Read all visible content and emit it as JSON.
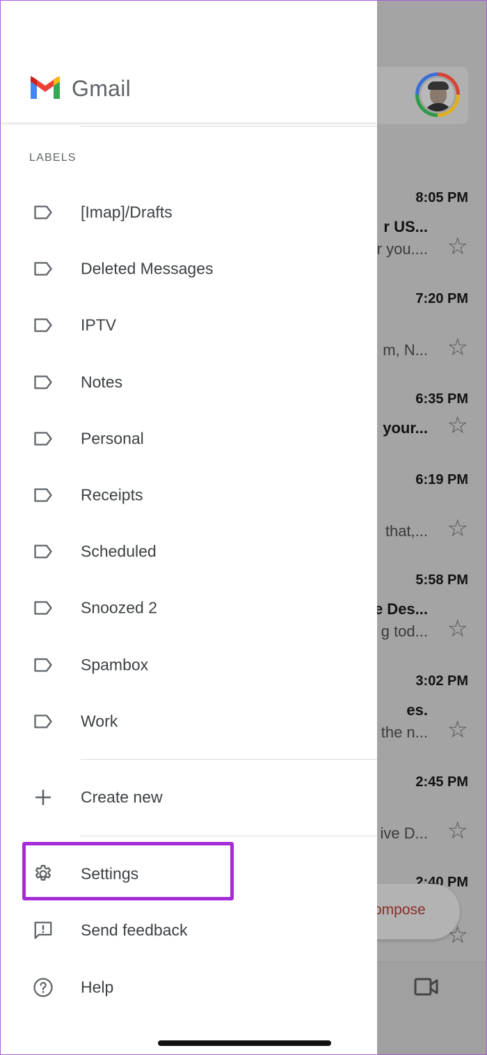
{
  "app": {
    "name": "Gmail"
  },
  "drawer": {
    "labels_heading": "LABELS",
    "labels": [
      {
        "label": "[Imap]/Drafts",
        "icon": "label-icon"
      },
      {
        "label": "Deleted Messages",
        "icon": "label-icon"
      },
      {
        "label": "IPTV",
        "icon": "label-icon"
      },
      {
        "label": "Notes",
        "icon": "label-icon"
      },
      {
        "label": "Personal",
        "icon": "label-icon"
      },
      {
        "label": "Receipts",
        "icon": "label-icon"
      },
      {
        "label": "Scheduled",
        "icon": "label-icon"
      },
      {
        "label": "Snoozed 2",
        "icon": "label-icon"
      },
      {
        "label": "Spambox",
        "icon": "label-icon"
      },
      {
        "label": "Work",
        "icon": "label-icon"
      }
    ],
    "create_new": "Create new",
    "settings": "Settings",
    "send_feedback": "Send feedback",
    "help": "Help"
  },
  "inbox": {
    "emails": [
      {
        "time": "8:05 PM",
        "subject": "r US...",
        "preview": "r you...."
      },
      {
        "time": "7:20 PM",
        "subject": "",
        "preview": "m, N..."
      },
      {
        "time": "6:35 PM",
        "subject": "your...",
        "preview": ""
      },
      {
        "time": "6:19 PM",
        "subject": "",
        "preview": "that,..."
      },
      {
        "time": "5:58 PM",
        "subject": "e Des...",
        "preview": "g tod..."
      },
      {
        "time": "3:02 PM",
        "subject": "es.",
        "preview": "the n..."
      },
      {
        "time": "2:45 PM",
        "subject": "",
        "preview": "ive D..."
      },
      {
        "time": "2:40 PM",
        "subject": "",
        "preview": ""
      }
    ],
    "compose_label": "ompose"
  },
  "colors": {
    "highlight": "#a52bd6",
    "compose_text": "#8a2c27",
    "gmail_red": "#ea4335",
    "gmail_blue": "#4285f4",
    "gmail_green": "#34a853",
    "gmail_yellow": "#fbbc04"
  }
}
